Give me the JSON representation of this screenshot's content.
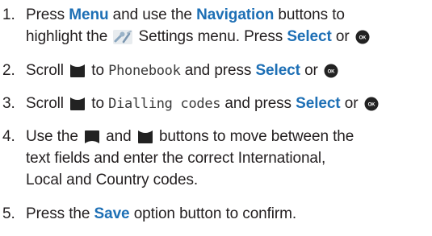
{
  "steps": [
    {
      "number": "1.",
      "text_1": "Press",
      "menu": "Menu",
      "text_2": "and use the",
      "navigation": "Navigation",
      "text_3": "buttons to",
      "text_4": "highlight the",
      "text_5": "Settings menu. Press",
      "select": "Select",
      "text_6": "or",
      "icons": [
        "settings-wrench-icon",
        "ok-button-icon"
      ]
    },
    {
      "number": "2.",
      "text_1": "Scroll",
      "text_2": "to",
      "screen_text": "Phonebook",
      "text_3": "and press",
      "select": "Select",
      "text_4": "or",
      "icons": [
        "scroll-down-icon",
        "ok-button-icon"
      ]
    },
    {
      "number": "3.",
      "text_1": "Scroll",
      "text_2": "to",
      "screen_text": "Dialling codes",
      "text_3": "and press",
      "select": "Select",
      "text_4": "or",
      "icons": [
        "scroll-down-icon",
        "ok-button-icon"
      ]
    },
    {
      "number": "4.",
      "text_1": "Use the",
      "text_2": "and",
      "text_3": "buttons to move between the",
      "line_2": "text fields and enter the correct International,",
      "line_3": "Local and Country codes.",
      "icons": [
        "scroll-up-icon",
        "scroll-down-icon"
      ]
    },
    {
      "number": "5.",
      "text_1": "Press the",
      "save": "Save",
      "text_2": "option button to confirm."
    }
  ],
  "colors": {
    "keyword": "#1d6fb5",
    "text": "#231f20",
    "icon": "#222222"
  }
}
